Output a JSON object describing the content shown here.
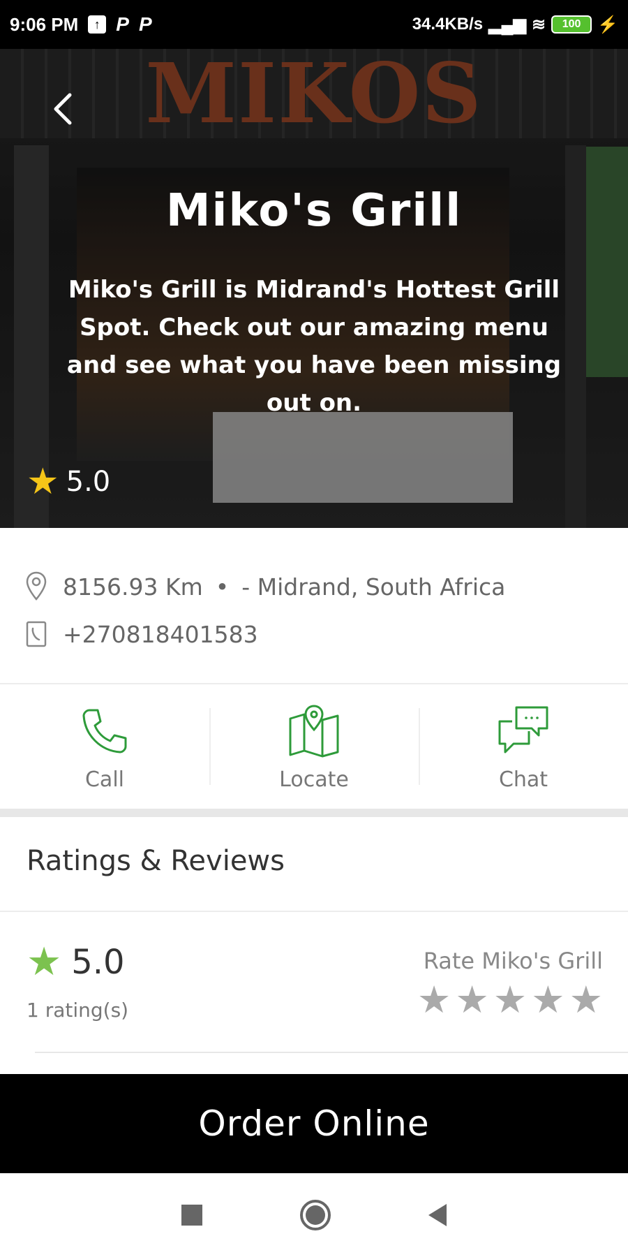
{
  "status_bar": {
    "time": "9:06 PM",
    "icons_left": [
      "upload-icon",
      "parking-icon",
      "parking-icon"
    ],
    "network_speed": "34.4KB/s",
    "battery": "100"
  },
  "hero": {
    "sign_text": "MIKOS",
    "title": "Miko's Grill",
    "description": "Miko's Grill is Midrand's Hottest Grill Spot. Check out our amazing menu and see what you have been missing out on.",
    "rating": "5.0"
  },
  "info": {
    "distance": "8156.93 Km",
    "separator": "•",
    "location": "- Midrand, South Africa",
    "phone": "+270818401583"
  },
  "actions": [
    {
      "label": "Call",
      "icon": "phone-icon"
    },
    {
      "label": "Locate",
      "icon": "map-pin-icon"
    },
    {
      "label": "Chat",
      "icon": "chat-icon"
    }
  ],
  "ratings": {
    "header": "Ratings & Reviews",
    "score": "5.0",
    "count": "1 rating(s)",
    "rate_label": "Rate Miko's Grill",
    "stars": 0,
    "max_stars": 5
  },
  "order_button": "Order Online",
  "colors": {
    "accent_green": "#2e9b3a",
    "star_yellow": "#f5c518",
    "star_green": "#7cc24f",
    "star_empty": "#aaaaaa"
  }
}
